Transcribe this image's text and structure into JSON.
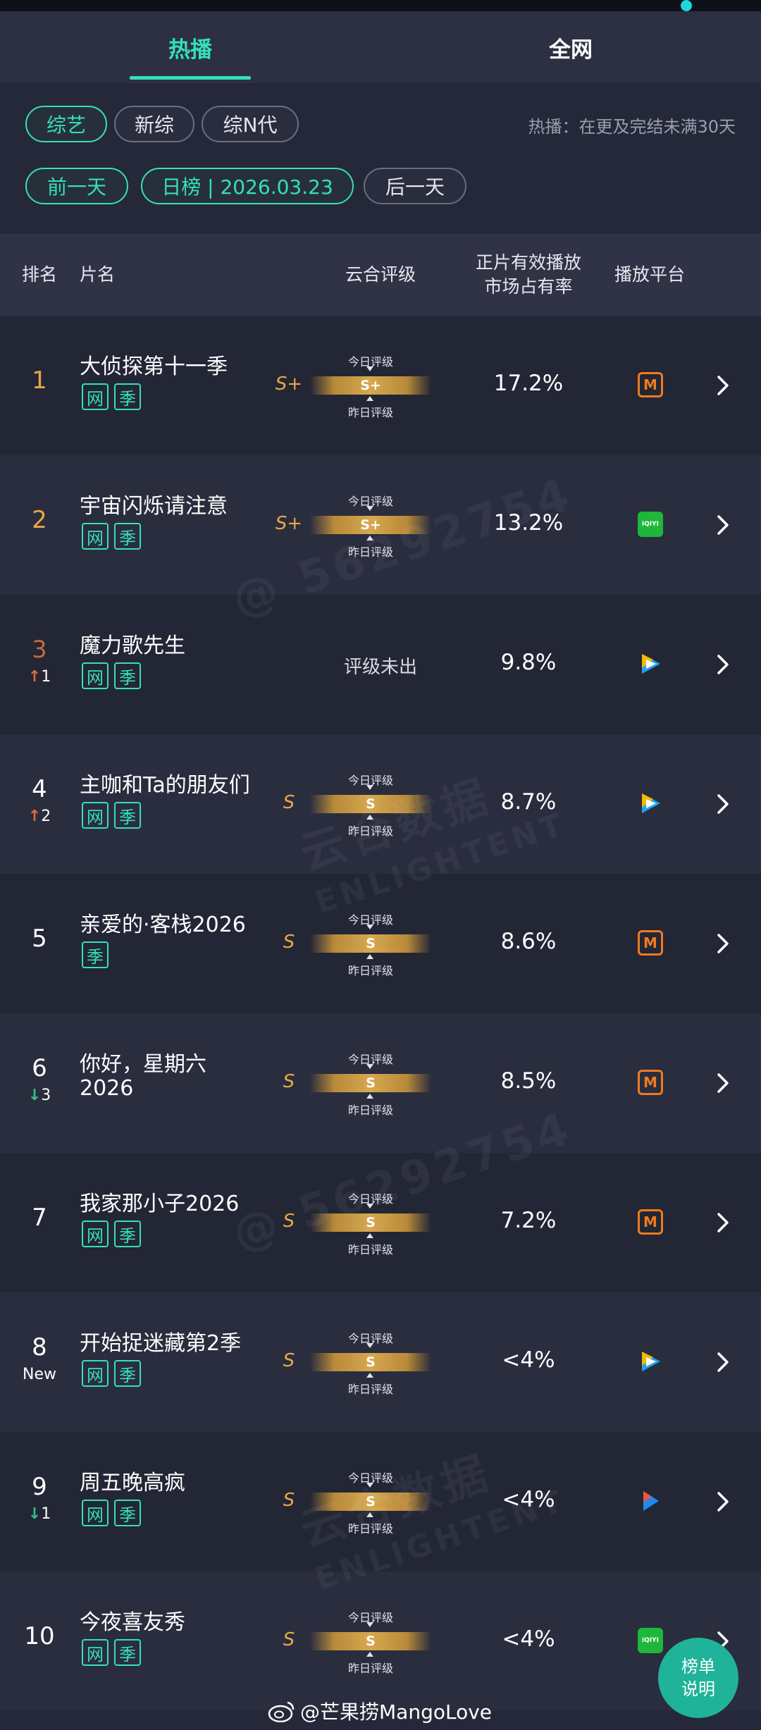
{
  "tabs": [
    {
      "label": "热播",
      "active": true
    },
    {
      "label": "全网",
      "active": false
    }
  ],
  "filters": {
    "categories": [
      "综艺",
      "新综",
      "综N代"
    ],
    "note": "热播：在更及完结未满30天",
    "prev_day": "前一天",
    "date_label": "日榜 | 2026.03.23",
    "next_day": "后一天"
  },
  "table_header": {
    "rank": "排名",
    "title": "片名",
    "rating": "云合评级",
    "share_line1": "正片有效播放",
    "share_line2": "市场占有率",
    "platform": "播放平台"
  },
  "rating_labels": {
    "today": "今日评级",
    "yesterday": "昨日评级"
  },
  "rows": [
    {
      "rank": "1",
      "change": "",
      "title": "大侦探第十一季",
      "tags": [
        "网",
        "季"
      ],
      "grade": "S+",
      "rating": "S+",
      "share": "17.2%",
      "platform": "mango-tv-icon"
    },
    {
      "rank": "2",
      "change": "",
      "title": "宇宙闪烁请注意",
      "tags": [
        "网",
        "季"
      ],
      "grade": "S+",
      "rating": "S+",
      "share": "13.2%",
      "platform": "iqiyi-icon"
    },
    {
      "rank": "3",
      "change": "1",
      "change_dir": "up",
      "title": "魔力歌先生",
      "tags": [
        "网",
        "季"
      ],
      "grade": "",
      "rating": "评级未出",
      "share": "9.8%",
      "platform": "tencent-video-icon"
    },
    {
      "rank": "4",
      "change": "2",
      "change_dir": "up",
      "title": "主咖和Ta的朋友们",
      "tags": [
        "网",
        "季"
      ],
      "grade": "S",
      "rating": "S",
      "share": "8.7%",
      "platform": "tencent-video-icon"
    },
    {
      "rank": "5",
      "change": "",
      "title": "亲爱的·客栈2026",
      "tags": [
        "季"
      ],
      "grade": "S",
      "rating": "S",
      "share": "8.6%",
      "platform": "mango-tv-icon"
    },
    {
      "rank": "6",
      "change": "3",
      "change_dir": "down",
      "title": "你好，星期六",
      "title2": "2026",
      "tags": [],
      "grade": "S",
      "rating": "S",
      "share": "8.5%",
      "platform": "mango-tv-icon"
    },
    {
      "rank": "7",
      "change": "",
      "title": "我家那小子2026",
      "tags": [
        "网",
        "季"
      ],
      "grade": "S",
      "rating": "S",
      "share": "7.2%",
      "platform": "mango-tv-icon"
    },
    {
      "rank": "8",
      "change": "New",
      "change_dir": "new",
      "title": "开始捉迷藏第2季",
      "tags": [
        "网",
        "季"
      ],
      "grade": "S",
      "rating": "S",
      "share": "<4%",
      "platform": "tencent-video-icon"
    },
    {
      "rank": "9",
      "change": "1",
      "change_dir": "down",
      "title": "周五晚高疯",
      "tags": [
        "网",
        "季"
      ],
      "grade": "S",
      "rating": "S",
      "share": "<4%",
      "platform": "youku-icon"
    },
    {
      "rank": "10",
      "change": "",
      "title": "今夜喜友秀",
      "tags": [
        "网",
        "季"
      ],
      "grade": "S",
      "rating": "S",
      "share": "<4%",
      "platform": "iqiyi-icon"
    }
  ],
  "platform_glyphs": {
    "mango": "M",
    "iqiyi": "iQIYI"
  },
  "watermarks": [
    "@ 56292754",
    "云合数据",
    "ENLIGHTENT"
  ],
  "fab": {
    "line1": "榜单",
    "line2": "说明"
  },
  "footer": "@芒果捞MangoLove",
  "colors": {
    "accent": "#35e0b8",
    "gold": "#e8a845",
    "up": "#e06a3a",
    "down": "#35c08c",
    "mango": "#f07b1e",
    "iqiyi": "#1fb63c"
  }
}
